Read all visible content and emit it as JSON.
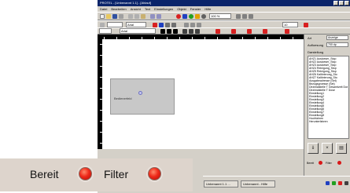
{
  "window": {
    "title": "PROTEL - [Unbenannt 1.1] - [Ablauf]"
  },
  "menu": [
    "Datei",
    "Bearbeiten",
    "Ansicht",
    "Text",
    "Einstellungen",
    "Objekt",
    "Fenster",
    "Hilfe"
  ],
  "toolbar": {
    "font_field": "Arial",
    "font_field2": "Arial",
    "size_field": "10",
    "zoom_field": "100 %",
    "accent_colors": [
      "#d82020",
      "#2040c0",
      "#20a020",
      "#e0a000"
    ]
  },
  "canvas": {
    "selection_label": "Bedienerfeld"
  },
  "panel": {
    "label1": "Art",
    "field1": "Anzeige",
    "label2": "Aufloesung",
    "field2": "700 dp",
    "label3": "Darstellung",
    "list_items": [
      "AHZ1 Ausloeser_Stop",
      "AHZ2 Ausloeser_Stop",
      "AHZ3 Ausloeser_Stop",
      "AHZ4 Reinigung_Stop",
      "AHZ5 Reinigung_Stop",
      "AHZ6 Kalibrierung_Sto",
      "AHZ7 Kalibrierung_Sto",
      "Ausgabeadresse (Set)",
      "Bezugsgroesse (Set)",
      "Dezimalstelle T Gesamtzeit Dose",
      "Dezimalstelle T Dose",
      "Einstellung1",
      "Einstellung2",
      "Einstellung3",
      "Einstellung4",
      "Einstellung5",
      "Einstellung6",
      "Einstellung7",
      "Einstellung8",
      "Hochfahren",
      "Herunterfahren"
    ],
    "buttons": [
      "⇓",
      "×",
      "▤"
    ],
    "status": [
      "Bereit",
      "Filter"
    ]
  },
  "taskbar": {
    "tasks": [
      "Unbenannt 1.1 ...",
      "Unbenannt - Hilfe"
    ]
  },
  "zoom_inset": {
    "label_ready": "Bereit",
    "label_filter": "Filter",
    "indicator_color": "#e8281a"
  }
}
